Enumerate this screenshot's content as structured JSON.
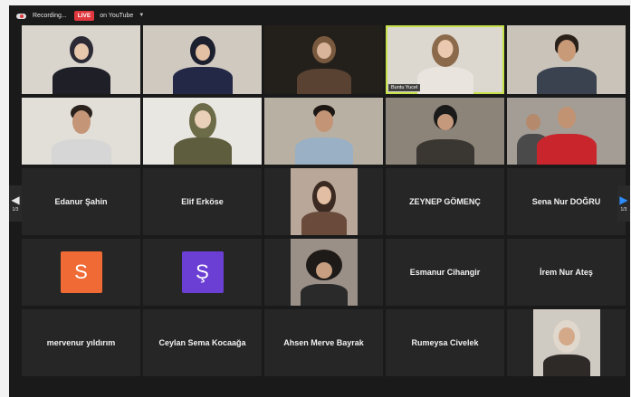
{
  "topbar": {
    "recording_label": "Recording...",
    "live_badge": "LIVE",
    "youtube_label": "on YouTube"
  },
  "pagination": {
    "left_page": "1/3",
    "right_page": "1/3"
  },
  "colors": {
    "accent_active": "#c6e24a",
    "live_red": "#e0383e",
    "avatar_s": "#f06a35",
    "avatar_sh": "#6b3fd4",
    "nav_blue": "#2d8cff"
  },
  "video_row1": [
    {
      "caption": ""
    },
    {
      "caption": ""
    },
    {
      "caption": ""
    },
    {
      "caption": "Buntu Yucel"
    },
    {
      "caption": ""
    }
  ],
  "names": {
    "r3c1": "Edanur Şahin",
    "r3c2": "Elif Erköse",
    "r3c4": "ZEYNEP GÖMENÇ",
    "r3c5": "Sena Nur DOĞRU",
    "r4c1_avatar": "S",
    "r4c2_avatar": "Ş",
    "r4c4": "Esmanur Cihangir",
    "r4c5": "İrem Nur Ateş",
    "r5c1": "mervenur yıldırım",
    "r5c2": "Ceylan Sema Kocaağa",
    "r5c3": "Ahsen Merve Bayrak",
    "r5c4": "Rumeysa Civelek"
  }
}
